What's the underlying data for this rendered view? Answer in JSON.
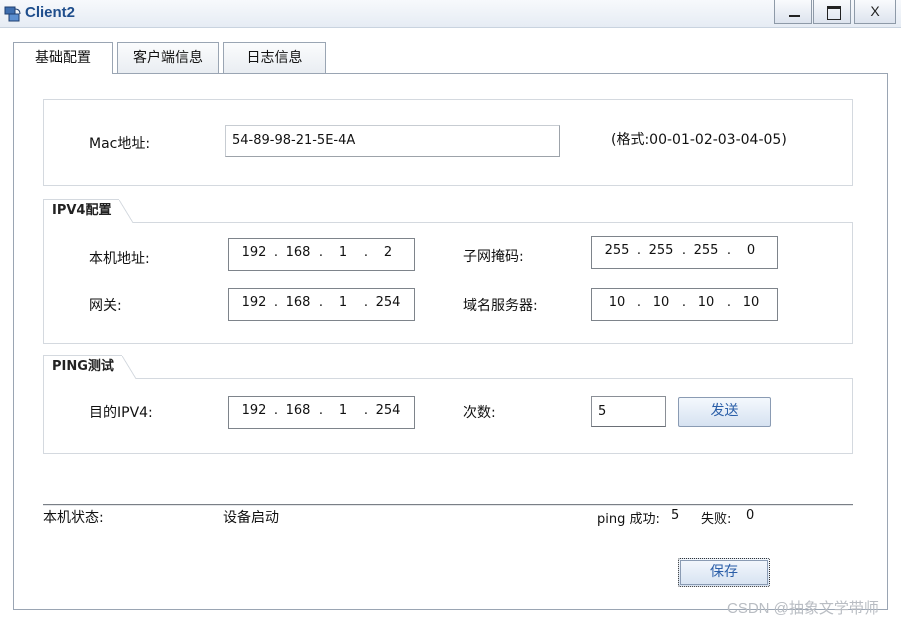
{
  "window": {
    "title": "Client2",
    "controls": {
      "minimize": "",
      "maximize": "",
      "close": "X"
    }
  },
  "tabs": [
    {
      "label": "基础配置",
      "active": true
    },
    {
      "label": "客户端信息",
      "active": false
    },
    {
      "label": "日志信息",
      "active": false
    }
  ],
  "mac": {
    "label": "Mac地址:",
    "value": "54-89-98-21-5E-4A",
    "format_hint": "(格式:00-01-02-03-04-05)"
  },
  "ipv4": {
    "section_title": "IPV4配置",
    "host_ip_label": "本机地址:",
    "host_ip": [
      "192",
      "168",
      "1",
      "2"
    ],
    "mask_label": "子网掩码:",
    "mask": [
      "255",
      "255",
      "255",
      "0"
    ],
    "gateway_label": "网关:",
    "gateway": [
      "192",
      "168",
      "1",
      "254"
    ],
    "dns_label": "域名服务器:",
    "dns": [
      "10",
      "10",
      "10",
      "10"
    ]
  },
  "ping": {
    "section_title": "PING测试",
    "target_label": "目的IPV4:",
    "target": [
      "192",
      "168",
      "1",
      "254"
    ],
    "count_label": "次数:",
    "count": "5",
    "send_label": "发送"
  },
  "status": {
    "label": "本机状态:",
    "value": "设备启动",
    "ping_success_label": "ping 成功:",
    "ping_success": "5",
    "ping_fail_label": "失败:",
    "ping_fail": "0"
  },
  "save_label": "保存",
  "watermark": "CSDN @抽象文学带师",
  "colors": {
    "title": "#1f4e8c",
    "button_text": "#2a5ea8"
  }
}
